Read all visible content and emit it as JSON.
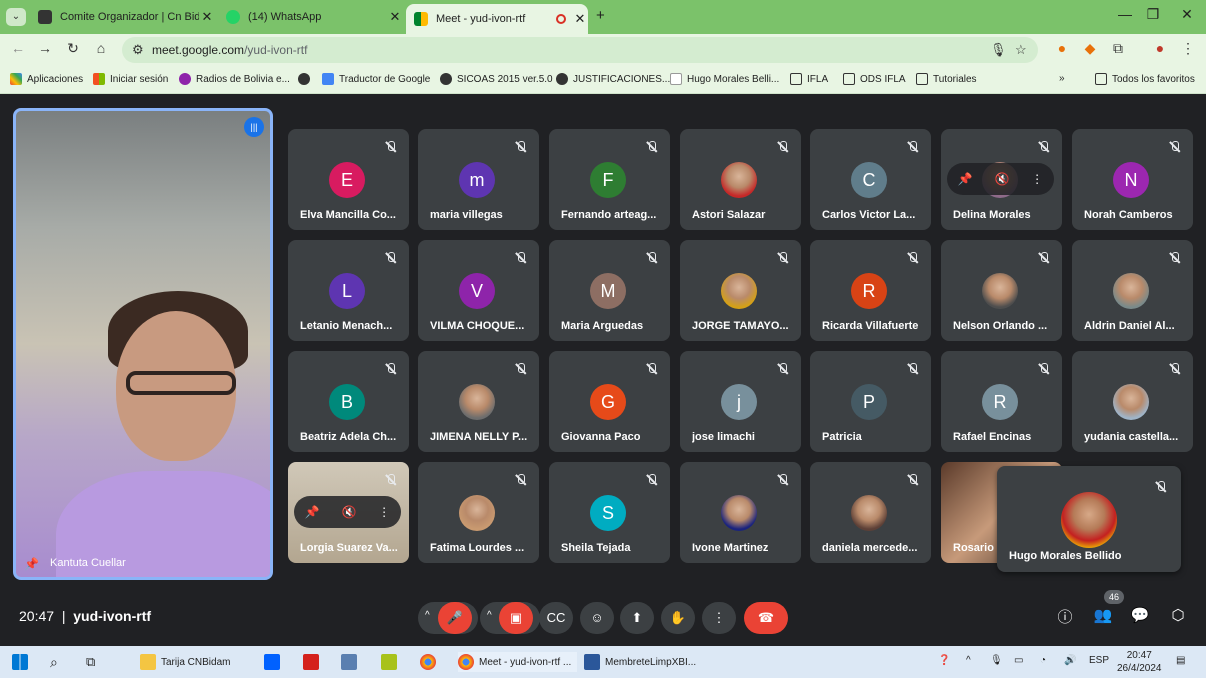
{
  "browser": {
    "tabs": [
      {
        "label": "Comite Organizador | Cn Bidan",
        "favicon": "wix-icon",
        "active": false
      },
      {
        "label": "(14) WhatsApp",
        "favicon": "whatsapp-icon",
        "active": false
      },
      {
        "label": "Meet - yud-ivon-rtf",
        "favicon": "meet-icon",
        "active": true
      }
    ],
    "url_host": "meet.google.com",
    "url_path": "/yud-ivon-rtf",
    "bookmarks": [
      "Aplicaciones",
      "Iniciar sesión",
      "Radios de Bolivia e...",
      "",
      "Traductor de Google",
      "SICOAS 2015 ver.5.0",
      "JUSTIFICACIONES...",
      "Hugo Morales Belli...",
      "IFLA",
      "ODS IFLA",
      "Tutoriales"
    ],
    "bookmarks_all": "Todos los favoritos"
  },
  "meet": {
    "main_speaker": "Kantuta Cuellar",
    "participants": [
      {
        "name": "Elva Mancilla Co...",
        "initial": "E",
        "color": "#d81b60"
      },
      {
        "name": "maria villegas",
        "initial": "m",
        "color": "#5e35b1"
      },
      {
        "name": "Fernando arteag...",
        "initial": "F",
        "color": "#2e7d32"
      },
      {
        "name": "Astori Salazar",
        "initial": "",
        "color": "#c62828"
      },
      {
        "name": "Carlos Victor La...",
        "initial": "C",
        "color": "#607d8b"
      },
      {
        "name": "Delina Morales",
        "initial": "",
        "color": "#8e6a8a"
      },
      {
        "name": "Norah Camberos",
        "initial": "N",
        "color": "#9c27b0"
      },
      {
        "name": "Letanio Menach...",
        "initial": "L",
        "color": "#5e35b1"
      },
      {
        "name": "VILMA CHOQUE...",
        "initial": "V",
        "color": "#8e24aa"
      },
      {
        "name": "Maria Arguedas",
        "initial": "M",
        "color": "#8d6e63"
      },
      {
        "name": "JORGE TAMAYO...",
        "initial": "",
        "color": "#d4a017"
      },
      {
        "name": "Ricarda Villafuerte",
        "initial": "R",
        "color": "#d84315"
      },
      {
        "name": "Nelson Orlando ...",
        "initial": "",
        "color": "#4e4e4e"
      },
      {
        "name": "Aldrin Daniel Al...",
        "initial": "",
        "color": "#7a8a8a"
      },
      {
        "name": "Beatriz Adela Ch...",
        "initial": "B",
        "color": "#00897b"
      },
      {
        "name": "JIMENA NELLY P...",
        "initial": "",
        "color": "#6d6d6d"
      },
      {
        "name": "Giovanna Paco",
        "initial": "G",
        "color": "#e64a19"
      },
      {
        "name": "jose limachi",
        "initial": "j",
        "color": "#78909c"
      },
      {
        "name": "Patricia",
        "initial": "P",
        "color": "#455a64"
      },
      {
        "name": "Rafael Encinas",
        "initial": "R",
        "color": "#78909c"
      },
      {
        "name": "yudania castella...",
        "initial": "",
        "color": "#9fb4c8"
      },
      {
        "name": "Lorgia Suarez Va...",
        "initial": "",
        "color": "#c9b89a"
      },
      {
        "name": "Fatima Lourdes ...",
        "initial": "",
        "color": "#c99a70"
      },
      {
        "name": "Sheila Tejada",
        "initial": "S",
        "color": "#00acc1"
      },
      {
        "name": "Ivone Martinez",
        "initial": "",
        "color": "#1a237e"
      },
      {
        "name": "daniela mercede...",
        "initial": "",
        "color": "#5d4037"
      },
      {
        "name": "Rosario V",
        "initial": "",
        "color": "#6b4a3a"
      }
    ],
    "floating_participant": "Hugo Morales Bellido",
    "time": "20:47",
    "meeting_code": "yud-ivon-rtf",
    "participant_count": "46"
  },
  "taskbar": {
    "items": [
      "Tarija CNBidam",
      "",
      "",
      "",
      "",
      "",
      "Meet - yud-ivon-rtf ...",
      "MembreteLimpXBI..."
    ],
    "lang": "ESP",
    "clock_time": "20:47",
    "clock_date": "26/4/2024"
  }
}
